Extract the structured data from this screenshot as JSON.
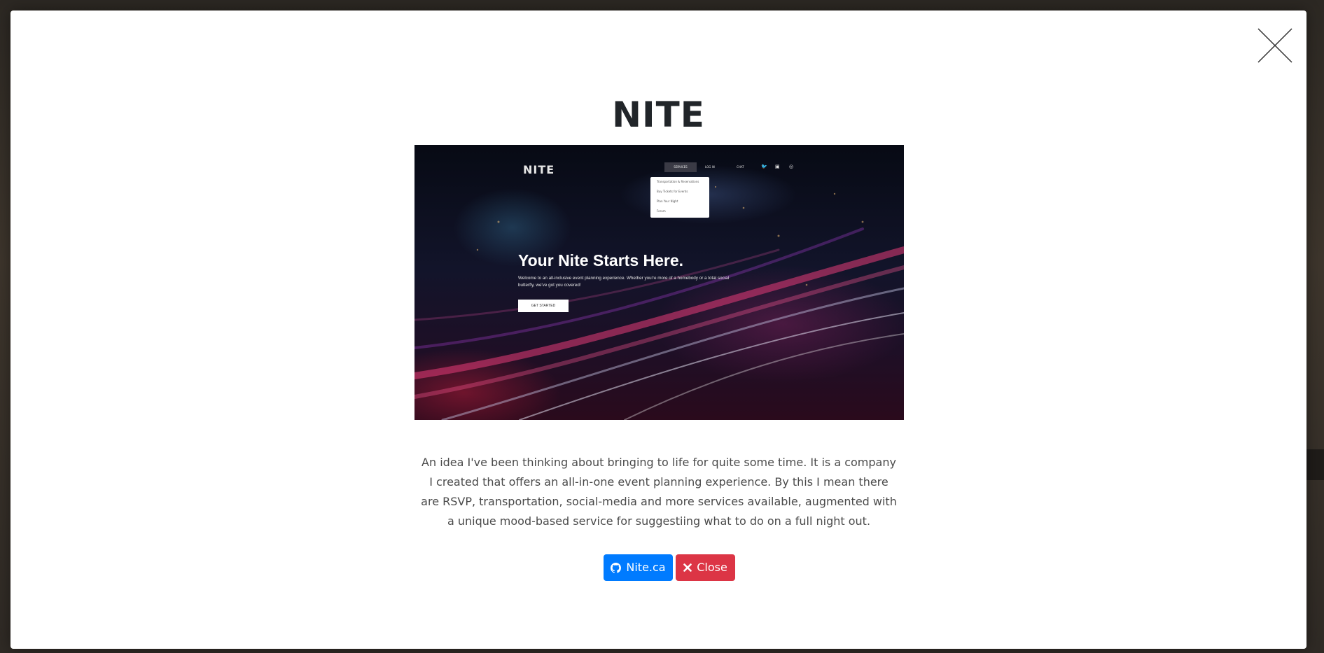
{
  "modal": {
    "title": "NITE",
    "description": "An idea I've been thinking about bringing to life for quite some time. It is a company I created that offers an all-in-one event planning experience. By this I mean there are RSVP, transportation, social-media and more services available, augmented with a unique mood-based service for suggestiing what to do on a full night out.",
    "close_icon": "close-x-icon",
    "buttons": {
      "github_label": "Nite.ca",
      "github_icon": "github-icon",
      "close_label": "Close",
      "close_icon": "times-icon"
    },
    "colors": {
      "primary": "#007bff",
      "danger": "#dc3545"
    }
  },
  "preview": {
    "logo": "NITE",
    "nav": {
      "services": "SERVICES",
      "login": "LOG IN",
      "chat": "CHAT"
    },
    "menu_items": [
      "Transportation & Reservations",
      "Buy Tickets for Events",
      "Plan Your Night",
      "Forum"
    ],
    "headline": "Your Nite Starts Here.",
    "subtext": "Welcome to an all-inclusive event planning experience. Whether you're more of a homebody or a total social butterfly, we've got you covered!",
    "cta": "GET STARTED"
  }
}
